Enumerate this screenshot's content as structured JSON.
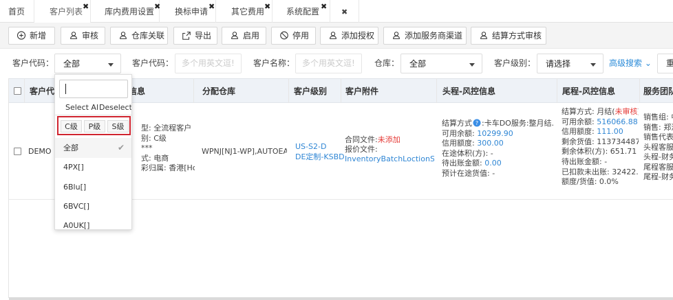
{
  "tabs": [
    {
      "label": "首页",
      "closable": false
    },
    {
      "label": "客户列表",
      "closable": true,
      "active": true
    },
    {
      "label": "库内费用设置",
      "closable": true
    },
    {
      "label": "换标申请",
      "closable": true
    },
    {
      "label": "其它费用",
      "closable": true
    },
    {
      "label": "系统配置",
      "closable": true
    }
  ],
  "tab_close_glyph": "✖",
  "tab_close_all": "✖",
  "toolbar": {
    "buttons": [
      {
        "label": "新增",
        "icon": "plus-circle-icon"
      },
      {
        "label": "审核",
        "icon": "user-icon"
      },
      {
        "label": "仓库关联",
        "icon": "user-icon"
      },
      {
        "label": "导出",
        "icon": "export-icon"
      },
      {
        "label": "启用",
        "icon": "user-icon"
      },
      {
        "label": "停用",
        "icon": "ban-icon"
      },
      {
        "label": "添加授权",
        "icon": "user-icon"
      },
      {
        "label": "添加服务商渠道",
        "icon": "user-icon"
      },
      {
        "label": "结算方式审核",
        "icon": "user-icon"
      }
    ]
  },
  "filter": {
    "customer_code_label": "客户代码：",
    "customer_code_select": "全部",
    "customer_code2_label": "客户代码：",
    "customer_code2_placeholder": "多个用英文逗!",
    "customer_name_label": "客户名称：",
    "customer_name_placeholder": "多个用英文逗!",
    "warehouse_label": "仓库：",
    "warehouse_select": "全部",
    "level_label": "客户级别：",
    "level_select": "请选择",
    "advanced_search": "高级搜索 ⌄",
    "reset_partial": "重"
  },
  "dropdown": {
    "select_all": "Select Al",
    "deselect_all": "Deselect A",
    "levels": [
      "C级",
      "P级",
      "S级"
    ],
    "options": [
      "全部",
      "4PX[]",
      "6Blu[]",
      "6BVC[]",
      "A0UK[]"
    ],
    "selected": "全部",
    "check": "✔"
  },
  "table": {
    "headers": {
      "code": "客户代",
      "info": "信息",
      "warehouse": "分配仓库",
      "level": "客户级别",
      "attach": "客户附件",
      "head_risk": "头程-风控信息",
      "tail_risk": "尾程-风控信息",
      "team": "服务团队"
    },
    "row": {
      "code": "DEMO",
      "info": [
        "型: 全流程客户",
        "别: C级",
        "***",
        "式: 电商",
        "彩归属: 香港[Hong..."
      ],
      "warehouse": "WPNJ[NJ1-WP],AUTOEA...",
      "level": [
        "US-S2-D",
        "DE定制-KSBD"
      ],
      "attach": {
        "contract_label": "合同文件:",
        "contract_value": "未添加",
        "quote_label": "报价文件:",
        "quote_value": "InventoryBatchLoctionSu..."
      },
      "head": {
        "settle_label": "结算方式",
        "settle_value": ":卡车DO服务:整月结...",
        "lines": [
          {
            "label": "可用余额:",
            "value": "10299.90"
          },
          {
            "label": "信用额度:",
            "value": "300.00"
          },
          {
            "label": "在途体积(方):",
            "value": "-"
          },
          {
            "label": "待出账金额:",
            "value": "0.00"
          },
          {
            "label": "预计在途货值:",
            "value": "-"
          }
        ]
      },
      "tail": {
        "settle_label": "结算方式: 月结(",
        "settle_status": "未审核",
        "settle_close": ")",
        "lines": [
          {
            "label": "可用余额:",
            "value": "516066.88",
            "blue": true
          },
          {
            "label": "信用额度:",
            "value": "111.00",
            "blue": true
          },
          {
            "label": "剩余货值:",
            "value": "113734487.05",
            "blue": false
          },
          {
            "label": "剩余体积(方):",
            "value": "651.71",
            "blue": false
          },
          {
            "label": "待出账金额:",
            "value": "-",
            "blue": false
          },
          {
            "label": "已扣款未出账:",
            "value": "32422.92",
            "blue": false
          },
          {
            "label": "额度/货值:",
            "value": "0.0%",
            "blue": false
          }
        ]
      },
      "team": [
        "销售组: 中",
        "销售: 郑洁",
        "销售代表:",
        "头程客服:",
        "头程-财务",
        "尾程客服:",
        "尾程-财务"
      ]
    }
  }
}
